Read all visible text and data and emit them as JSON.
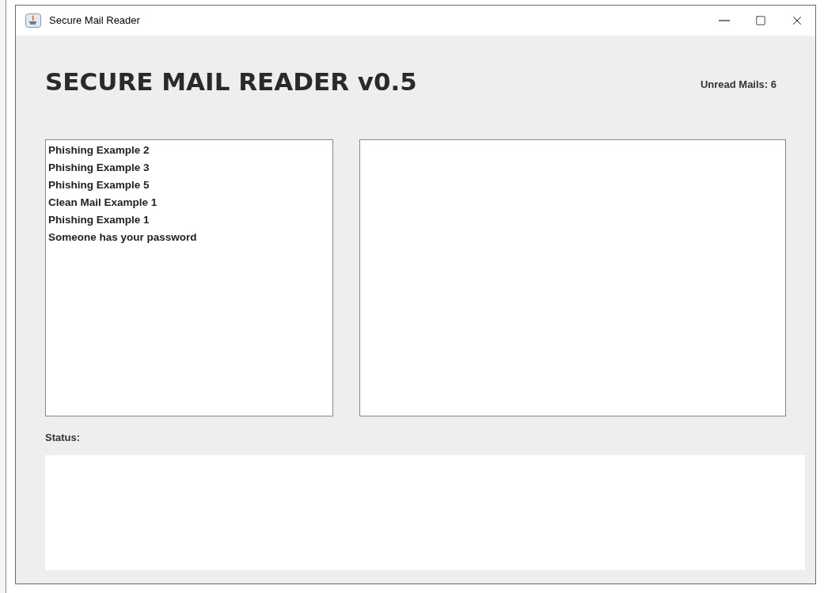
{
  "window": {
    "title": "Secure Mail Reader"
  },
  "header": {
    "title": "SECURE MAIL READER v0.5",
    "unread": "Unread Mails: 6"
  },
  "mail_list": {
    "items": [
      {
        "subject": "Phishing Example 2"
      },
      {
        "subject": "Phishing Example 3"
      },
      {
        "subject": "Phishing Example 5"
      },
      {
        "subject": "Clean Mail Example 1"
      },
      {
        "subject": "Phishing Example 1"
      },
      {
        "subject": "Someone has your password"
      }
    ]
  },
  "status": {
    "label": "Status:"
  }
}
